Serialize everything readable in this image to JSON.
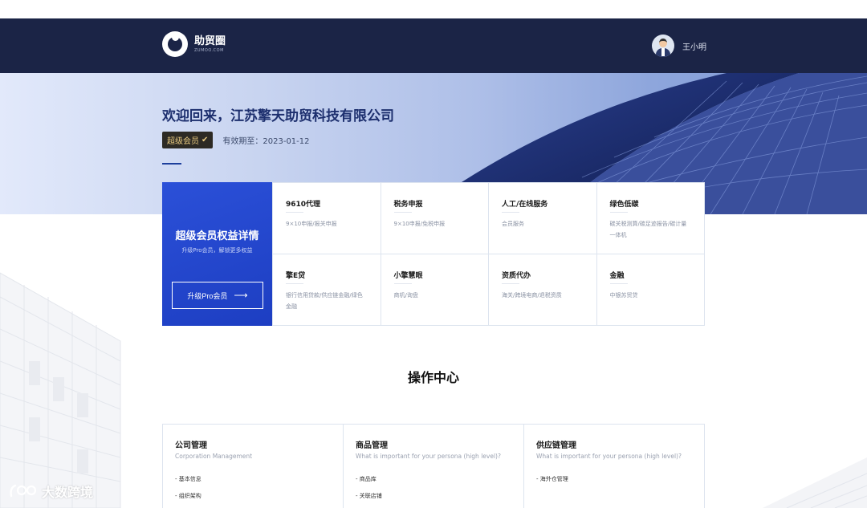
{
  "header": {
    "logo_name": "助贸圈",
    "logo_sub": "ZUMOO.COM",
    "username": "王小明"
  },
  "hero": {
    "welcome": "欢迎回来，江苏擎天助贸科技有限公司",
    "member_badge": "超级会员",
    "validity": "有效期至：2023-01-12"
  },
  "benefits": {
    "promo_title": "超级会员权益详情",
    "promo_sub": "升级Pro会员，解锁更多权益",
    "promo_button": "升级Pro会员",
    "items": [
      {
        "title": "9610代理",
        "desc": "9×10申报/报关申报"
      },
      {
        "title": "税务申报",
        "desc": "9×10申报/免税申报"
      },
      {
        "title": "人工/在线服务",
        "desc": "会员服务"
      },
      {
        "title": "绿色低碳",
        "desc": "碳关税测算/碳足迹报告/碳计量一体机"
      },
      {
        "title": "擎E贷",
        "desc": "银行信用贷款/供应链金融/绿色金融"
      },
      {
        "title": "小擎慧眼",
        "desc": "商机/询盘"
      },
      {
        "title": "资质代办",
        "desc": "海关/跨境电商/退税资质"
      },
      {
        "title": "金融",
        "desc": "中银苏贸贷"
      }
    ]
  },
  "ops": {
    "title": "操作中心",
    "columns": [
      {
        "title": "公司管理",
        "sub": "Corporation Management",
        "items": [
          "- 基本信息",
          "- 组织架构"
        ]
      },
      {
        "title": "商品管理",
        "sub": "What is important for your persona (high level)?",
        "items": [
          "- 商品库",
          "- 关联店铺"
        ]
      },
      {
        "title": "供应链管理",
        "sub": "What is important for your persona (high level)?",
        "items": [
          "- 海外仓管理"
        ]
      }
    ]
  },
  "watermark": "大数跨境",
  "icons": {
    "logo": "zumoo-logo-icon",
    "avatar": "user-avatar-icon",
    "arrow": "arrow-right-icon",
    "check": "check-icon"
  },
  "colors": {
    "navbar": "#1b2446",
    "accent": "#1d3ec2",
    "badge": "#2d2a24",
    "badge_text": "#e8c980"
  }
}
